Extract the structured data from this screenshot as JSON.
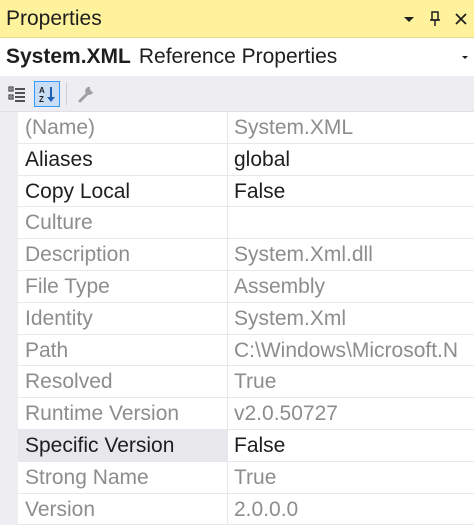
{
  "window": {
    "title": "Properties"
  },
  "selector": {
    "object_name": "System.XML",
    "object_type": "Reference Properties"
  },
  "toolbar": {
    "icons": [
      "categorized-icon",
      "alphabetical-icon",
      "property-pages-icon"
    ]
  },
  "properties": [
    {
      "name": "(Name)",
      "value": "System.XML"
    },
    {
      "name": "Aliases",
      "value": "global"
    },
    {
      "name": "Copy Local",
      "value": "False"
    },
    {
      "name": "Culture",
      "value": ""
    },
    {
      "name": "Description",
      "value": "System.Xml.dll"
    },
    {
      "name": "File Type",
      "value": "Assembly"
    },
    {
      "name": "Identity",
      "value": "System.Xml"
    },
    {
      "name": "Path",
      "value": "C:\\Windows\\Microsoft.N"
    },
    {
      "name": "Resolved",
      "value": "True"
    },
    {
      "name": "Runtime Version",
      "value": "v2.0.50727"
    },
    {
      "name": "Specific Version",
      "value": "False"
    },
    {
      "name": "Strong Name",
      "value": "True"
    },
    {
      "name": "Version",
      "value": "2.0.0.0"
    }
  ],
  "colors": {
    "title_bar": "#fff29d",
    "toolbar_bg": "#eeeef2",
    "readonly_text": "#8d8d8d",
    "editable_text": "#1e1e1e",
    "active_tool_border": "#3399ff"
  }
}
